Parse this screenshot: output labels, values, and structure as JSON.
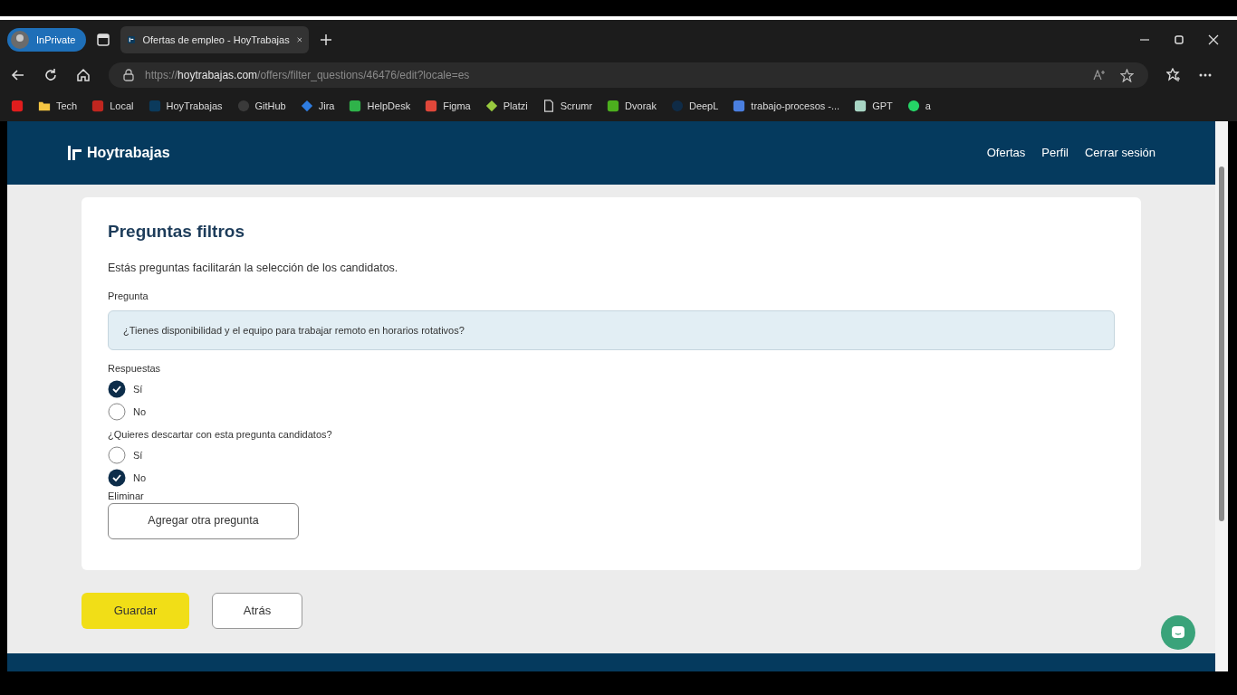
{
  "browser": {
    "profile": "InPrivate",
    "tab": {
      "title": "Ofertas de empleo - HoyTrabajas",
      "selected": true
    },
    "url": "https://**hoytrabajas.com**/offers/filter_questions/46476/edit?locale=es",
    "bookmarks": [
      {
        "kind": "square",
        "color": "#e11d1d"
      },
      {
        "label": "Tech",
        "kind": "folder",
        "color": "#f5c542"
      },
      {
        "label": "Local",
        "kind": "square",
        "color": "#c0261f"
      },
      {
        "label": "HoyTrabajas",
        "kind": "square",
        "color": "#0b3a5c"
      },
      {
        "label": "GitHub",
        "kind": "circle",
        "color": "#3a3a3a"
      },
      {
        "label": "Jira",
        "kind": "diamond",
        "color": "#2f7de1"
      },
      {
        "label": "HelpDesk",
        "kind": "square",
        "color": "#2fb34a"
      },
      {
        "label": "Figma",
        "kind": "square",
        "color": "#e0473a"
      },
      {
        "label": "Platzi",
        "kind": "diamond",
        "color": "#98ca3f"
      },
      {
        "label": "Scrumr",
        "kind": "page",
        "color": "#d4d4d4"
      },
      {
        "label": "Dvorak",
        "kind": "square",
        "color": "#4caf1e"
      },
      {
        "label": "DeepL",
        "kind": "circle",
        "color": "#0f2b46"
      },
      {
        "label": "trabajo-procesos -...",
        "kind": "square",
        "color": "#4a7fe0"
      },
      {
        "label": "GPT",
        "kind": "square",
        "color": "#a8d5c4"
      },
      {
        "label": "a",
        "kind": "circle",
        "color": "#25d366"
      }
    ]
  },
  "site": {
    "brand": "Hoytrabajas",
    "nav": [
      "Ofertas",
      "Perfil",
      "Cerrar sesión"
    ]
  },
  "card": {
    "title": "Preguntas filtros",
    "description": "Estás preguntas facilitarán la selección de los candidatos.",
    "question_label": "Pregunta",
    "question_value": "¿Tienes disponibilidad y el equipo para trabajar remoto en horarios rotativos?",
    "groups": [
      {
        "label": "Respuestas",
        "options": [
          {
            "label": "Sí",
            "selected": true
          },
          {
            "label": "No",
            "selected": false
          }
        ]
      },
      {
        "label": "¿Quieres descartar con esta pregunta candidatos?",
        "options": [
          {
            "label": "Sí",
            "selected": false
          },
          {
            "label": "No",
            "selected": true
          }
        ]
      }
    ],
    "delete_label": "Eliminar",
    "add_button": "Agregar otra pregunta"
  },
  "actions": {
    "save": "Guardar",
    "back": "Atrás"
  }
}
